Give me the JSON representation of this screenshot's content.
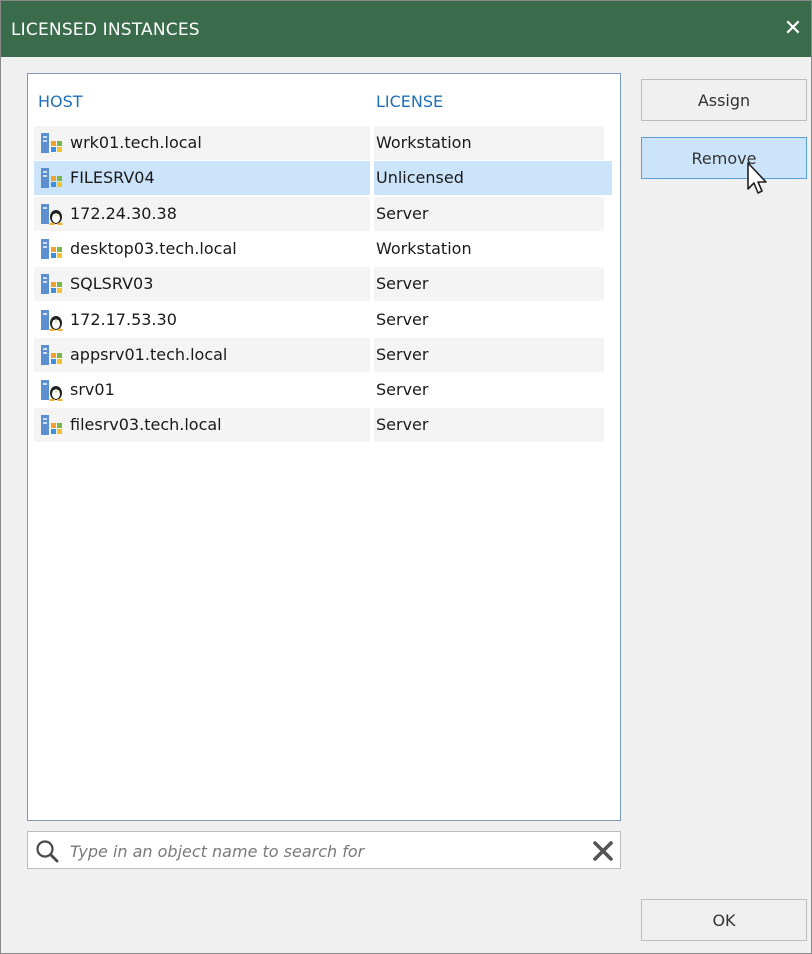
{
  "window": {
    "title": "LICENSED INSTANCES",
    "close_glyph": "✕"
  },
  "list": {
    "columns": {
      "host": "HOST",
      "license": "LICENSE"
    },
    "rows": [
      {
        "host": "wrk01.tech.local",
        "license": "Workstation",
        "icon": "windows-server-icon",
        "selected": false
      },
      {
        "host": "FILESRV04",
        "license": "Unlicensed",
        "icon": "windows-server-icon",
        "selected": true
      },
      {
        "host": "172.24.30.38",
        "license": "Server",
        "icon": "linux-server-icon",
        "selected": false
      },
      {
        "host": "desktop03.tech.local",
        "license": "Workstation",
        "icon": "windows-server-icon",
        "selected": false
      },
      {
        "host": "SQLSRV03",
        "license": "Server",
        "icon": "windows-server-icon",
        "selected": false
      },
      {
        "host": "172.17.53.30",
        "license": "Server",
        "icon": "linux-server-icon",
        "selected": false
      },
      {
        "host": "appsrv01.tech.local",
        "license": "Server",
        "icon": "windows-server-icon",
        "selected": false
      },
      {
        "host": "srv01",
        "license": "Server",
        "icon": "linux-server-icon",
        "selected": false
      },
      {
        "host": "filesrv03.tech.local",
        "license": "Server",
        "icon": "windows-server-icon",
        "selected": false
      }
    ]
  },
  "search": {
    "placeholder": "Type in an object name to search for",
    "value": ""
  },
  "buttons": {
    "assign": "Assign",
    "remove": "Remove",
    "ok": "OK"
  },
  "colors": {
    "titlebar": "#3a6c4c",
    "header_text": "#1f6fba",
    "selection": "#cce4fa",
    "button_hover": "#cce4fa"
  }
}
